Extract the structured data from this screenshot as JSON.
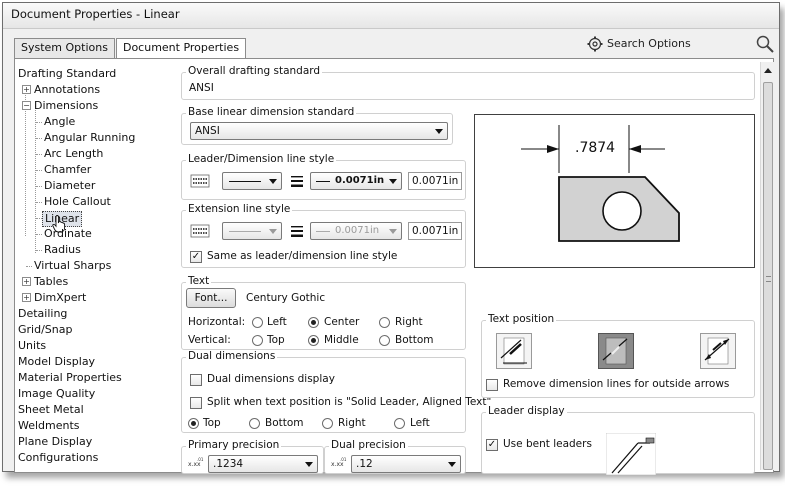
{
  "window": {
    "title": "Document Properties - Linear"
  },
  "tabs": [
    {
      "label": "System Options"
    },
    {
      "label": "Document Properties"
    }
  ],
  "search": {
    "label": "Search Options",
    "icon": "gear-icon",
    "search_icon": "magnifier-icon"
  },
  "tree": {
    "items": [
      {
        "label": "Drafting Standard",
        "level": 0
      },
      {
        "label": "Annotations",
        "level": 1,
        "expander": "+"
      },
      {
        "label": "Dimensions",
        "level": 1,
        "expander": "-"
      },
      {
        "label": "Angle",
        "level": 2
      },
      {
        "label": "Angular Running",
        "level": 2
      },
      {
        "label": "Arc Length",
        "level": 2
      },
      {
        "label": "Chamfer",
        "level": 2
      },
      {
        "label": "Diameter",
        "level": 2
      },
      {
        "label": "Hole Callout",
        "level": 2
      },
      {
        "label": "Linear",
        "level": 2,
        "selected": true
      },
      {
        "label": "Ordinate",
        "level": 2
      },
      {
        "label": "Radius",
        "level": 2
      },
      {
        "label": "Virtual Sharps",
        "level": 1
      },
      {
        "label": "Tables",
        "level": 1,
        "expander": "+"
      },
      {
        "label": "DimXpert",
        "level": 1,
        "expander": "+"
      },
      {
        "label": "Detailing",
        "level": 0
      },
      {
        "label": "Grid/Snap",
        "level": 0
      },
      {
        "label": "Units",
        "level": 0
      },
      {
        "label": "Model Display",
        "level": 0
      },
      {
        "label": "Material Properties",
        "level": 0
      },
      {
        "label": "Image Quality",
        "level": 0
      },
      {
        "label": "Sheet Metal",
        "level": 0
      },
      {
        "label": "Weldments",
        "level": 0
      },
      {
        "label": "Plane Display",
        "level": 0
      },
      {
        "label": "Configurations",
        "level": 0
      }
    ]
  },
  "overall": {
    "legend": "Overall drafting standard",
    "value": "ANSI"
  },
  "base_standard": {
    "legend": "Base linear dimension standard",
    "value": "ANSI"
  },
  "leader_style": {
    "legend": "Leader/Dimension line style",
    "thickness": "0.0071in",
    "custom": "0.0071in"
  },
  "extension_style": {
    "legend": "Extension line style",
    "thickness": "0.0071in",
    "custom": "0.0071in",
    "same_as_label": "Same as leader/dimension line style",
    "same_as_checked": true
  },
  "text": {
    "legend": "Text",
    "font_button": "Font...",
    "font_name": "Century Gothic",
    "horizontal_label": "Horizontal:",
    "horizontal_options": [
      "Left",
      "Center",
      "Right"
    ],
    "horizontal_selected": "Center",
    "vertical_label": "Vertical:",
    "vertical_options": [
      "Top",
      "Middle",
      "Bottom"
    ],
    "vertical_selected": "Middle"
  },
  "dual": {
    "legend": "Dual dimensions",
    "display_label": "Dual dimensions display",
    "display_checked": false,
    "split_label": "Split when text position is \"Solid Leader, Aligned Text\"",
    "split_checked": false,
    "split_options": [
      "Top",
      "Bottom",
      "Right",
      "Left"
    ],
    "split_selected": "Top"
  },
  "primary_precision": {
    "legend": "Primary precision",
    "value": ".1234"
  },
  "dual_precision": {
    "legend": "Dual precision",
    "value": ".12"
  },
  "preview": {
    "dimension_text": ".7874"
  },
  "text_position": {
    "legend": "Text position",
    "selected_index": 1,
    "remove_lines_label": "Remove dimension lines for outside arrows",
    "remove_lines_checked": false
  },
  "leader_display": {
    "legend": "Leader display",
    "bent_label": "Use bent leaders",
    "bent_checked": true
  }
}
